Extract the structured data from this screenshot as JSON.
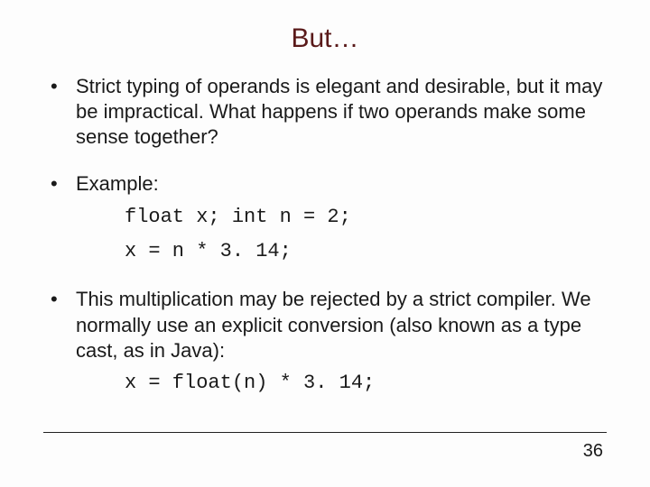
{
  "title": "But…",
  "bullets": [
    {
      "text": "Strict typing of operands is elegant and desirable, but it may be impractical. What happens if two operands make some sense together?"
    },
    {
      "text": " Example:",
      "code": [
        "float x; int n = 2;",
        "x = n * 3. 14;"
      ]
    },
    {
      "text": "This multiplication may be rejected by a strict compiler. We normally use an explicit conversion (also known as a type cast, as in Java):",
      "code": [
        "x = float(n) * 3. 14;"
      ]
    }
  ],
  "page_number": "36"
}
